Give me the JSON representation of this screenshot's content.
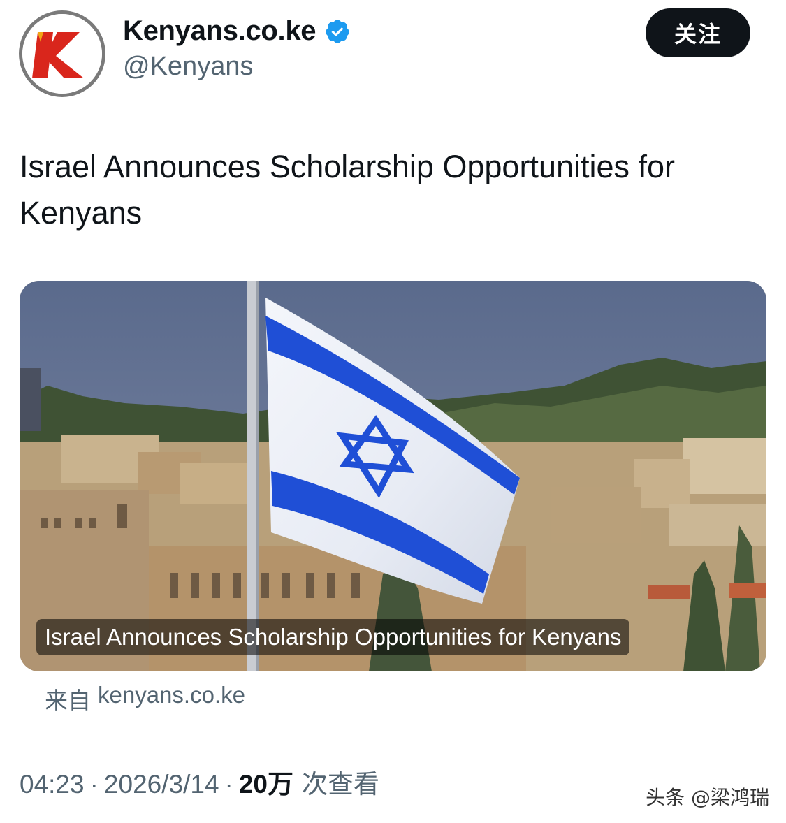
{
  "header": {
    "display_name": "Kenyans.co.ke",
    "handle": "@Kenyans",
    "follow_label": "关注",
    "verified_icon": "verified-badge-icon",
    "verified_color": "#1d9bf0"
  },
  "tweet": {
    "text": "Israel Announces Scholarship Opportunities for Kenyans"
  },
  "card": {
    "title": "Israel Announces Scholarship Opportunities for Kenyans",
    "source_prefix": "来自",
    "source_domain": "kenyans.co.ke"
  },
  "meta": {
    "time": "04:23",
    "date": "2026/3/14",
    "separator": "·",
    "views_count": "20万",
    "views_label": "次查看"
  },
  "watermark": "头条 @梁鸿瑞",
  "colors": {
    "brand_red": "#d9261c",
    "flag_blue": "#1f4fd6",
    "text_primary": "#0f1419",
    "text_secondary": "#536471"
  }
}
